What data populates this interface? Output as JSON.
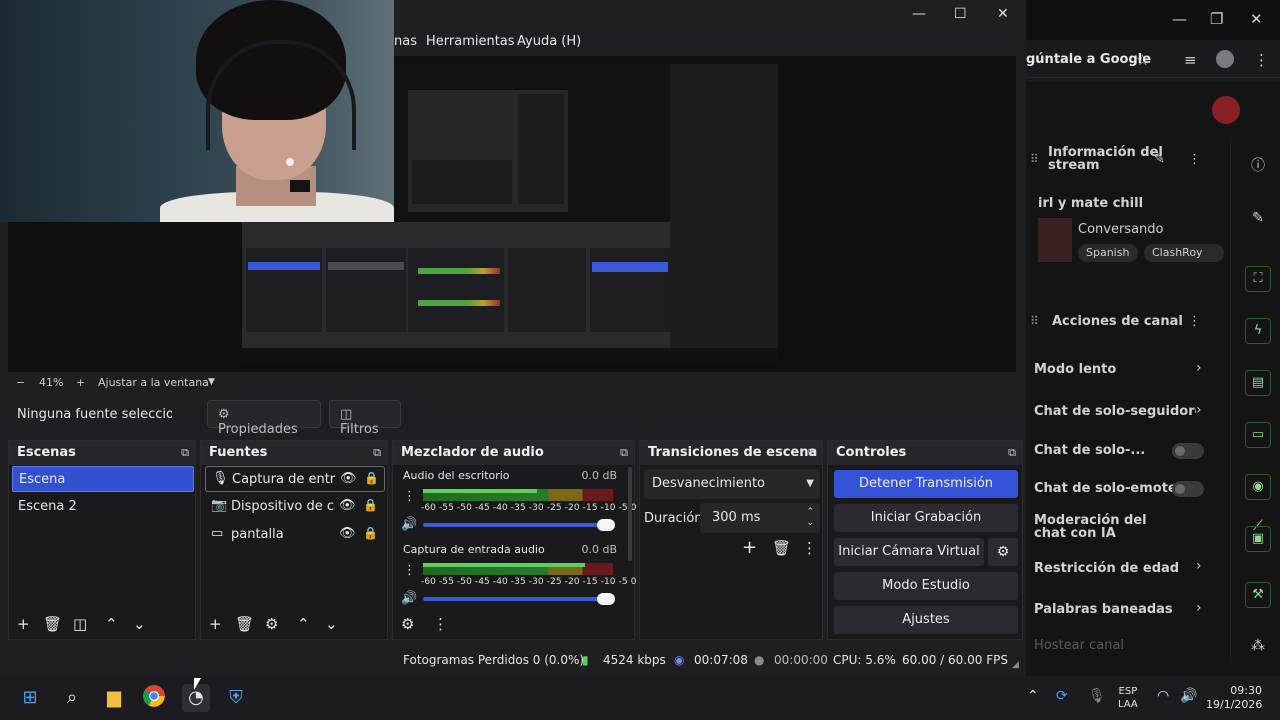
{
  "obs": {
    "menu": [
      "nas",
      "Herramientas",
      "Ayuda (H)"
    ],
    "zoom": {
      "level": "41%",
      "fit_label": "Ajustar a la ventana"
    },
    "source_toolbar": {
      "no_selection": "Ninguna fuente seleccionad",
      "properties": "Propiedades",
      "filters": "Filtros"
    },
    "scenes": {
      "title": "Escenas",
      "items": [
        "Escena",
        "Escena 2"
      ]
    },
    "sources": {
      "title": "Fuentes",
      "items": [
        "Captura de entrada de audio",
        "Dispositivo de captura de video",
        "pantalla"
      ]
    },
    "mixer": {
      "title": "Mezclador de audio",
      "channels": [
        {
          "name": "Audio del escritorio",
          "db": "0.0 dB",
          "level": 0.6
        },
        {
          "name": "Captura de entrada audio",
          "db": "0.0 dB",
          "level": 0.85
        }
      ],
      "scale": "-60 -55 -50 -45 -40 -35 -30 -25 -20 -15 -10 -5 0"
    },
    "transitions": {
      "title": "Transiciones de escena",
      "selected": "Desvanecimiento",
      "duration_label": "Duración",
      "duration_value": "300 ms"
    },
    "controls": {
      "title": "Controles",
      "stop_stream": "Detener Transmisión",
      "start_recording": "Iniciar Grabación",
      "start_virtual_cam": "Iniciar Cámara Virtual",
      "studio_mode": "Modo Estudio",
      "settings": "Ajustes"
    },
    "status": {
      "dropped_frames": "Fotogramas Perdidos 0 (0.0%)",
      "bitrate": "4524 kbps",
      "stream_time": "00:07:08",
      "rec_time": "00:00:00",
      "cpu": "CPU: 5.6%",
      "fps": "60.00 / 60.00 FPS"
    }
  },
  "browser": {
    "url_fragment": "gúntale a Google",
    "stream_info": "Información del stream",
    "stream_title": "irl y mate chill",
    "category": "Conversando",
    "tags": [
      "Spanish",
      "ClashRoy"
    ],
    "channel_actions": "Acciones de canal",
    "settings": [
      {
        "label": "Modo lento",
        "kind": "chevron"
      },
      {
        "label": "Chat de solo-seguidores",
        "kind": "chevron"
      },
      {
        "label": "Chat de solo-...",
        "kind": "toggle"
      },
      {
        "label": "Chat de solo-emotes",
        "kind": "toggle"
      },
      {
        "label": "Moderación del chat con IA",
        "kind": "none"
      },
      {
        "label": "Restricción de edad",
        "kind": "chevron"
      },
      {
        "label": "Palabras baneadas",
        "kind": "chevron"
      },
      {
        "label": "Hostear canal",
        "kind": "dim"
      }
    ]
  },
  "taskbar": {
    "lang": "ESP",
    "layout": "LAA",
    "time": "09:30",
    "date": "19/1/2026"
  }
}
